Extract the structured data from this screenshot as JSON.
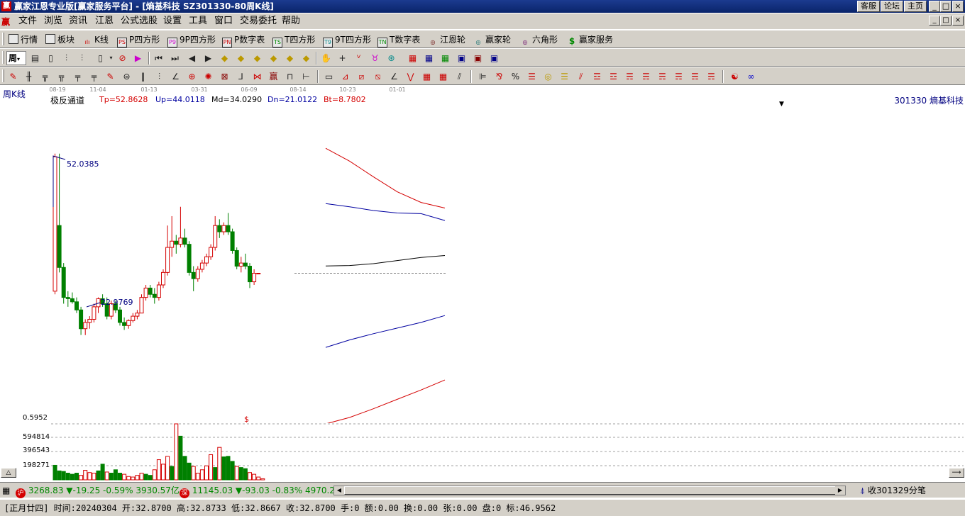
{
  "window": {
    "title": "赢家江恩专业版[赢家服务平台] - [熵基科技   SZ301330-80周K线]",
    "buttons": [
      "客服",
      "论坛",
      "主页"
    ],
    "logo_char": "赢",
    "minimize": "_",
    "restore": "□",
    "close": "×"
  },
  "menu": {
    "items": [
      "文件",
      "浏览",
      "资讯",
      "江恩",
      "公式选股",
      "设置",
      "工具",
      "窗口",
      "交易委托",
      "帮助"
    ]
  },
  "toolbar1": {
    "items": [
      {
        "label": "行情",
        "icon": "grid-icon"
      },
      {
        "label": "板块",
        "icon": "blocks-icon"
      },
      {
        "label": "K线",
        "icon": "candles-icon"
      },
      {
        "label": "P四方形",
        "icon": "ps-icon",
        "tag": "PS"
      },
      {
        "label": "9P四方形",
        "icon": "p9-icon",
        "tag": "P9"
      },
      {
        "label": "P数字表",
        "icon": "pn-icon",
        "tag": "PN"
      },
      {
        "label": "T四方形",
        "icon": "ts-icon",
        "tag": "TS"
      },
      {
        "label": "9T四方形",
        "icon": "t9-icon",
        "tag": "T9"
      },
      {
        "label": "T数字表",
        "icon": "tn-icon",
        "tag": "TN"
      },
      {
        "label": "江恩轮",
        "icon": "gann-wheel-icon",
        "tag": "◎"
      },
      {
        "label": "赢家轮",
        "icon": "winner-wheel-icon",
        "tag": "◎"
      },
      {
        "label": "六角形",
        "icon": "hexagon-icon",
        "tag": "◎"
      },
      {
        "label": "赢家服务",
        "icon": "dollar-icon",
        "tag": "$"
      }
    ]
  },
  "toolbar2": {
    "period": "周",
    "tag_dropdown": "▾"
  },
  "chart": {
    "period_label": "周K线",
    "stock_label": "301330  熵基科技",
    "indicator": {
      "name": "极反通道",
      "tp": "Tp=52.8628",
      "up": "Up=44.0118",
      "md": "Md=34.0290",
      "dn": "Dn=21.0122",
      "bt": "Bt=8.7802"
    },
    "date_ticks": [
      "08-19",
      "11-04",
      "01-13",
      "03-31",
      "06-09",
      "08-14",
      "10-23",
      "01-01"
    ],
    "high_label": "52.0385",
    "low_label": "22.9769",
    "volume_ticks": [
      "0.5952",
      "594814",
      "396543",
      "198271"
    ],
    "dollar_marker": "$",
    "colors": {
      "up": "#d40000",
      "down": "#008000",
      "channel_top": "#d40000",
      "channel_up": "#0000a0",
      "channel_mid": "#000000",
      "label_blue": "#000080"
    },
    "candles": [
      [
        30.0,
        52.0,
        29.5,
        51.5
      ],
      [
        40.5,
        52.0,
        33.0,
        33.8
      ],
      [
        33.8,
        34.5,
        28.0,
        29.0
      ],
      [
        29.0,
        30.0,
        27.5,
        28.8
      ],
      [
        28.8,
        29.8,
        28.0,
        28.3
      ],
      [
        28.3,
        29.0,
        26.5,
        27.0
      ],
      [
        27.0,
        27.5,
        23.0,
        24.0
      ],
      [
        24.0,
        25.5,
        22.98,
        25.0
      ],
      [
        25.0,
        26.0,
        24.0,
        25.5
      ],
      [
        25.5,
        28.0,
        25.0,
        27.5
      ],
      [
        27.5,
        29.0,
        26.5,
        28.8
      ],
      [
        28.8,
        29.5,
        27.5,
        28.0
      ],
      [
        28.0,
        29.0,
        25.5,
        26.0
      ],
      [
        26.0,
        28.5,
        25.5,
        28.0
      ],
      [
        28.0,
        28.5,
        26.5,
        27.0
      ],
      [
        27.0,
        27.5,
        24.5,
        25.0
      ],
      [
        25.0,
        25.8,
        23.8,
        24.5
      ],
      [
        24.5,
        25.5,
        24.0,
        25.3
      ],
      [
        25.3,
        26.5,
        25.0,
        26.0
      ],
      [
        26.0,
        27.0,
        25.5,
        26.5
      ],
      [
        26.5,
        29.5,
        26.5,
        29.0
      ],
      [
        29.0,
        31.0,
        28.5,
        30.5
      ],
      [
        30.5,
        31.0,
        29.0,
        29.5
      ],
      [
        29.5,
        30.5,
        28.0,
        29.0
      ],
      [
        29.0,
        31.5,
        28.5,
        31.0
      ],
      [
        31.0,
        33.5,
        30.5,
        33.0
      ],
      [
        33.0,
        40.5,
        32.5,
        37.0
      ],
      [
        37.0,
        42.0,
        35.5,
        38.0
      ],
      [
        38.0,
        39.0,
        36.0,
        37.5
      ],
      [
        37.5,
        43.5,
        37.0,
        38.5
      ],
      [
        38.5,
        40.0,
        37.0,
        37.5
      ],
      [
        37.5,
        38.0,
        32.5,
        33.0
      ],
      [
        33.0,
        34.0,
        30.0,
        32.0
      ],
      [
        32.0,
        34.0,
        31.5,
        33.5
      ],
      [
        33.5,
        35.0,
        33.0,
        34.5
      ],
      [
        34.5,
        36.0,
        34.0,
        35.5
      ],
      [
        35.5,
        37.5,
        35.0,
        37.0
      ],
      [
        37.0,
        42.0,
        36.5,
        40.5
      ],
      [
        40.5,
        41.5,
        38.5,
        39.5
      ],
      [
        39.5,
        41.0,
        39.0,
        40.5
      ],
      [
        40.5,
        42.5,
        39.0,
        39.5
      ],
      [
        39.5,
        40.0,
        36.0,
        36.5
      ],
      [
        36.5,
        37.0,
        33.5,
        34.0
      ],
      [
        34.0,
        35.5,
        33.0,
        34.5
      ],
      [
        34.5,
        36.0,
        33.5,
        34.0
      ],
      [
        34.0,
        34.5,
        30.5,
        31.5
      ],
      [
        31.5,
        33.5,
        31.0,
        32.87
      ],
      [
        32.87,
        32.87,
        32.87,
        32.87
      ]
    ],
    "volumes": [
      0.36,
      0.26,
      0.16,
      0.15,
      0.12,
      0.1,
      0.12,
      0.08,
      0.17,
      0.13,
      0.12,
      0.16,
      0.28,
      0.14,
      0.12,
      0.18,
      0.12,
      0.1,
      0.06,
      0.05,
      0.08,
      0.12,
      0.1,
      0.08,
      0.18,
      0.36,
      0.28,
      0.42,
      0.24,
      1.0,
      0.78,
      0.42,
      0.3,
      0.24,
      0.12,
      0.18,
      0.25,
      0.45,
      0.22,
      0.58,
      0.41,
      0.42,
      0.33,
      0.24,
      0.22,
      0.2,
      0.13,
      0.1,
      0.05,
      0.02
    ],
    "channel": {
      "top": [
        52.86,
        50.8,
        48.3,
        45.9,
        44.2,
        43.3
      ],
      "up": [
        44.01,
        43.5,
        42.9,
        42.5,
        42.4,
        41.3
      ],
      "mid": [
        34.03,
        34.1,
        34.4,
        34.9,
        35.4,
        35.7
      ],
      "dn": [
        21.01,
        22.2,
        23.2,
        24.1,
        25.0,
        26.1
      ],
      "bt": [
        8.78,
        9.8,
        11.2,
        12.7,
        14.2,
        15.8
      ]
    },
    "last_close": 32.87,
    "price_range": [
      8.78,
      60.7
    ]
  },
  "status1": {
    "sh": {
      "badge": "沪",
      "value": "3268.83",
      "arrow": "▼",
      "change": "-19.25",
      "pct": "-0.59%",
      "amount": "3930.57亿"
    },
    "sz": {
      "badge": "深",
      "value": "11145.03",
      "arrow": "▼",
      "change": "-93.03",
      "pct": "-0.83%",
      "amount": "4970.2"
    },
    "right_text": "收301329分笔"
  },
  "status2": {
    "text": "[正月廿四] 时间:20240304 开:32.8700 高:32.8733 低:32.8667 收:32.8700 手:0 额:0.00 换:0.00 张:0.00 盘:0 标:46.9562"
  }
}
